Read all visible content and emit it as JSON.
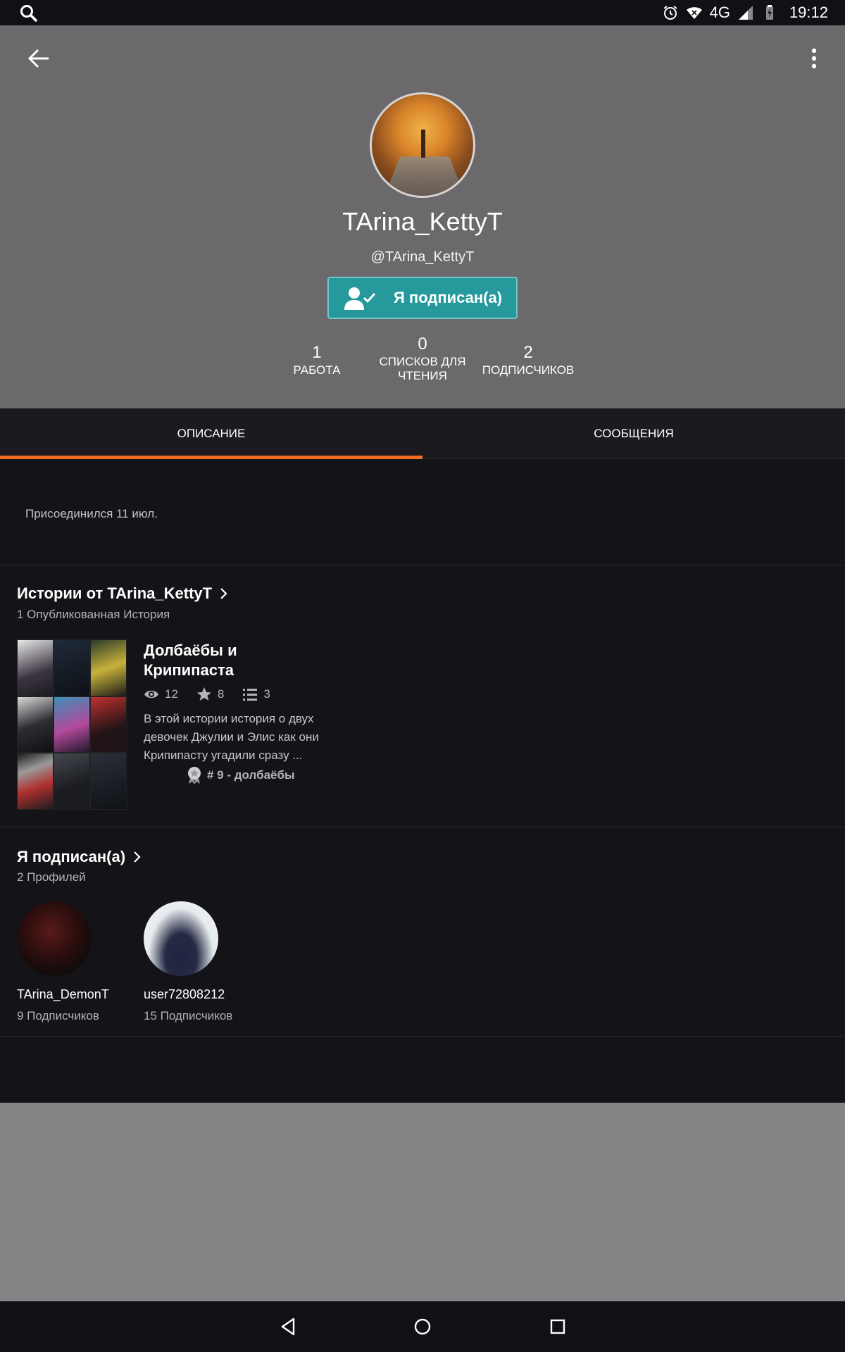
{
  "status_bar": {
    "time": "19:12",
    "network": "4G",
    "icons": [
      "search-icon",
      "alarm-icon",
      "wifi-icon",
      "signal-icon",
      "battery-icon"
    ]
  },
  "profile": {
    "display_name": "TArina_KettyT",
    "handle": "@TArina_KettyT",
    "follow_button_label": "Я подписан(а)",
    "stats": [
      {
        "value": "1",
        "label": "РАБОТА"
      },
      {
        "value": "0",
        "label": "СПИСКОВ ДЛЯ ЧТЕНИЯ"
      },
      {
        "value": "2",
        "label": "ПОДПИСЧИКОВ"
      }
    ]
  },
  "tabs": [
    {
      "label": "ОПИСАНИЕ",
      "active": true
    },
    {
      "label": "СООБЩЕНИЯ",
      "active": false
    }
  ],
  "about": {
    "joined": "Присоединился 11 июл."
  },
  "stories_section": {
    "title": "Истории от TArina_KettyT",
    "subtitle": "1 Опубликованная История",
    "story": {
      "title": "Долбаёбы и Крипипаста",
      "reads": "12",
      "votes": "8",
      "parts": "3",
      "description": "В этой истории история о двух девочек Джулии и Элис как они Крипипасту угадили сразу ...",
      "rank": "# 9 - долбаёбы"
    }
  },
  "following_section": {
    "title": "Я подписан(а)",
    "subtitle": "2 Профилей",
    "profiles": [
      {
        "name": "TArina_DemonT",
        "followers": "9 Подписчиков"
      },
      {
        "name": "user72808212",
        "followers": "15 Подписчиков"
      }
    ]
  },
  "colors": {
    "accent": "#f36c21",
    "follow_button": "#25999c",
    "header_bg": "#6b696c",
    "content_bg": "#141317"
  }
}
